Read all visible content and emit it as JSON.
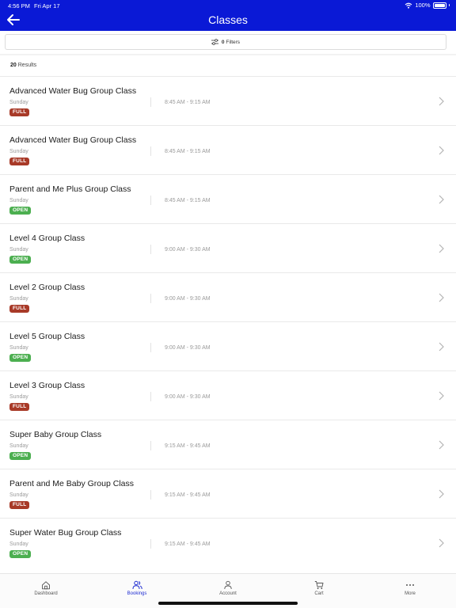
{
  "status_bar": {
    "time": "4:56 PM",
    "date": "Fri Apr 17",
    "battery": "100%"
  },
  "header": {
    "title": "Classes",
    "back_icon": "arrow-left-icon",
    "bg_color": "#0a19d6"
  },
  "filters": {
    "count": "0",
    "label": "Filters",
    "icon": "sliders-icon"
  },
  "results": {
    "count": "20",
    "label": "Results"
  },
  "classes": [
    {
      "name": "Advanced Water Bug Group Class",
      "day": "Sunday",
      "time": "8:45 AM - 9:15 AM",
      "status": "FULL"
    },
    {
      "name": "Advanced Water Bug Group Class",
      "day": "Sunday",
      "time": "8:45 AM - 9:15 AM",
      "status": "FULL"
    },
    {
      "name": "Parent and Me Plus Group Class",
      "day": "Sunday",
      "time": "8:45 AM - 9:15 AM",
      "status": "OPEN"
    },
    {
      "name": "Level 4 Group Class",
      "day": "Sunday",
      "time": "9:00 AM - 9:30 AM",
      "status": "OPEN"
    },
    {
      "name": "Level 2 Group Class",
      "day": "Sunday",
      "time": "9:00 AM - 9:30 AM",
      "status": "FULL"
    },
    {
      "name": "Level 5 Group Class",
      "day": "Sunday",
      "time": "9:00 AM - 9:30 AM",
      "status": "OPEN"
    },
    {
      "name": "Level 3 Group Class",
      "day": "Sunday",
      "time": "9:00 AM - 9:30 AM",
      "status": "FULL"
    },
    {
      "name": "Super Baby Group Class",
      "day": "Sunday",
      "time": "9:15 AM - 9:45 AM",
      "status": "OPEN"
    },
    {
      "name": "Parent and Me Baby Group Class",
      "day": "Sunday",
      "time": "9:15 AM - 9:45 AM",
      "status": "FULL"
    },
    {
      "name": "Super Water Bug Group Class",
      "day": "Sunday",
      "time": "9:15 AM - 9:45 AM",
      "status": "OPEN"
    }
  ],
  "status_colors": {
    "FULL": "#a83a28",
    "OPEN": "#4caf50"
  },
  "tab_bar": {
    "active_color": "#1d2bd1",
    "tabs": [
      {
        "label": "Dashboard",
        "icon": "home-icon"
      },
      {
        "label": "Bookings",
        "icon": "people-icon",
        "active": true
      },
      {
        "label": "Account",
        "icon": "person-icon"
      },
      {
        "label": "Cart",
        "icon": "cart-icon"
      },
      {
        "label": "More",
        "icon": "more-icon"
      }
    ]
  }
}
